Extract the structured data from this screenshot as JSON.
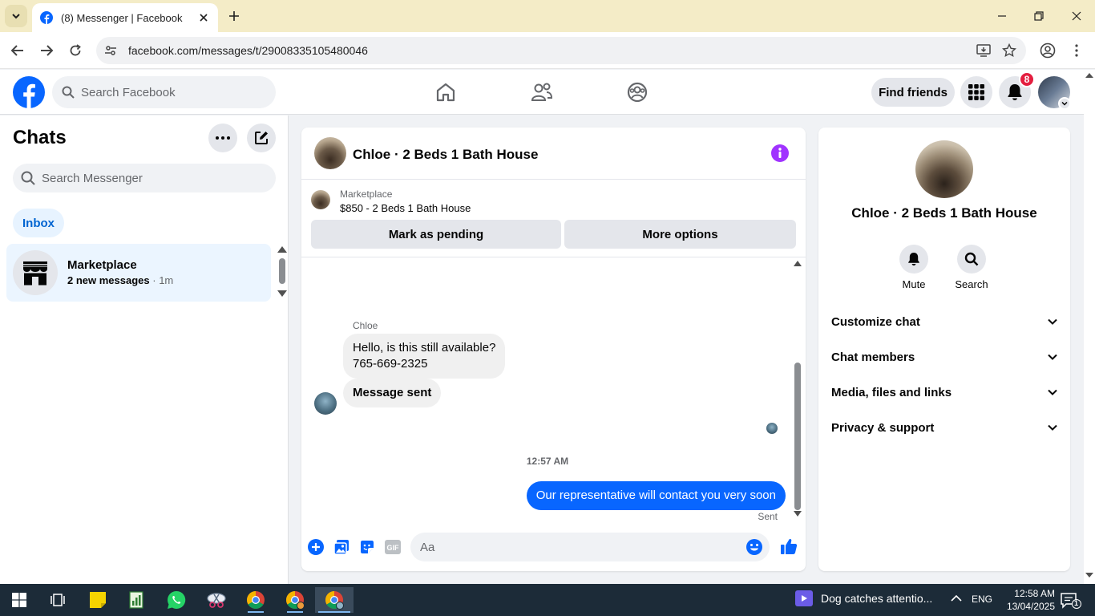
{
  "browser": {
    "tab_title": "(8) Messenger | Facebook",
    "url": "facebook.com/messages/t/29008335105480046"
  },
  "header": {
    "search_placeholder": "Search Facebook",
    "find_friends_label": "Find friends",
    "notification_count": "8",
    "brand_color": "#0866ff"
  },
  "sidebar": {
    "title": "Chats",
    "search_placeholder": "Search Messenger",
    "filter_label": "Inbox",
    "chats": [
      {
        "name": "Marketplace",
        "preview": "2 new messages",
        "time": "1m"
      }
    ]
  },
  "conversation": {
    "title": "Chloe · 2 Beds 1 Bath House",
    "marketplace_label": "Marketplace",
    "listing": "$850 - 2 Beds 1 Bath House",
    "mark_pending_label": "Mark as pending",
    "more_options_label": "More options",
    "sender_name": "Chloe",
    "incoming": [
      {
        "line1": "Hello, is this still available?",
        "line2": "765-669-2325"
      },
      {
        "line1": "Message sent"
      }
    ],
    "timestamp": "12:57 AM",
    "outgoing": "Our representative will contact you very soon",
    "status": "Sent",
    "composer_placeholder": "Aa"
  },
  "info_panel": {
    "name": "Chloe · 2 Beds 1 Bath House",
    "actions": [
      {
        "label": "Mute"
      },
      {
        "label": "Search"
      }
    ],
    "sections": [
      {
        "label": "Customize chat"
      },
      {
        "label": "Chat members"
      },
      {
        "label": "Media, files and links"
      },
      {
        "label": "Privacy & support"
      }
    ]
  },
  "taskbar": {
    "news": "Dog catches attentio...",
    "language": "ENG",
    "time": "12:58 AM",
    "date": "13/04/2025",
    "notification_count": "1"
  }
}
